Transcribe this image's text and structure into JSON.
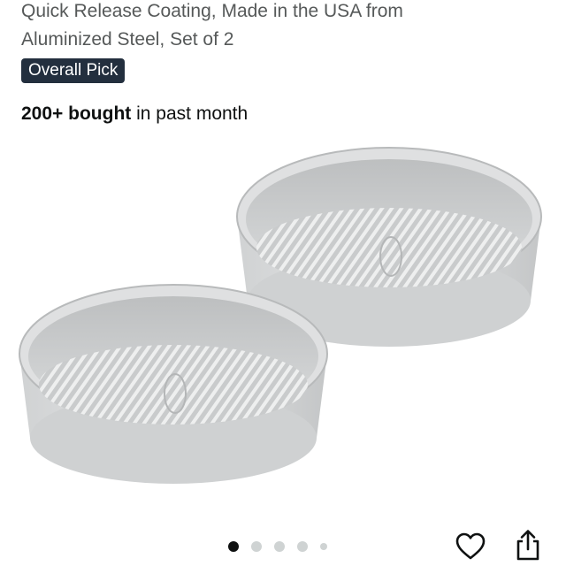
{
  "product": {
    "title_line1": "Quick Release Coating, Made in the USA from",
    "title_line2": "Aluminized Steel, Set of 2",
    "badge": "Overall Pick",
    "bought_count": "200+ bought",
    "bought_suffix": " in past month"
  },
  "image_carousel": {
    "current_index": 1,
    "total_dots": 5
  },
  "icons": {
    "wishlist": "heart-icon",
    "share": "share-icon"
  },
  "colors": {
    "badge_bg": "#232f3e",
    "badge_text": "#ffffff",
    "title_text": "#565959",
    "active_dot": "#0f1111",
    "inactive_dot": "#cfd3d3"
  }
}
